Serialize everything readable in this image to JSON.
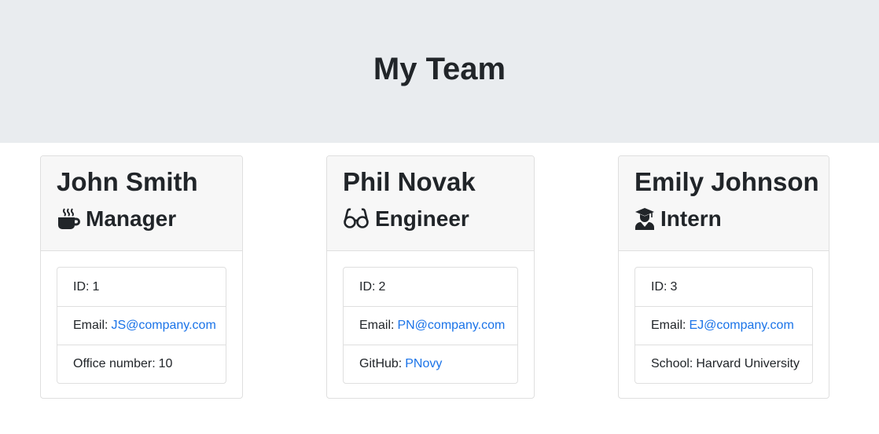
{
  "header": {
    "title": "My Team"
  },
  "employees": [
    {
      "name": "John Smith",
      "role": "Manager",
      "icon": "coffee-icon",
      "id_label": "ID:",
      "id": "1",
      "email_label": "Email:",
      "email": "JS@company.com",
      "extra_label": "Office number:",
      "extra_value": "10"
    },
    {
      "name": "Phil Novak",
      "role": "Engineer",
      "icon": "glasses-icon",
      "id_label": "ID:",
      "id": "2",
      "email_label": "Email:",
      "email": "PN@company.com",
      "extra_label": "GitHub:",
      "extra_value": "PNovy"
    },
    {
      "name": "Emily Johnson",
      "role": "Intern",
      "icon": "graduate-icon",
      "id_label": "ID:",
      "id": "3",
      "email_label": "Email:",
      "email": "EJ@company.com",
      "extra_label": "School:",
      "extra_value": "Harvard University"
    }
  ],
  "colors": {
    "header_bg": "#e9ecef",
    "card_header_bg": "#f7f7f7",
    "link": "#1a73e8",
    "text": "#212529"
  }
}
